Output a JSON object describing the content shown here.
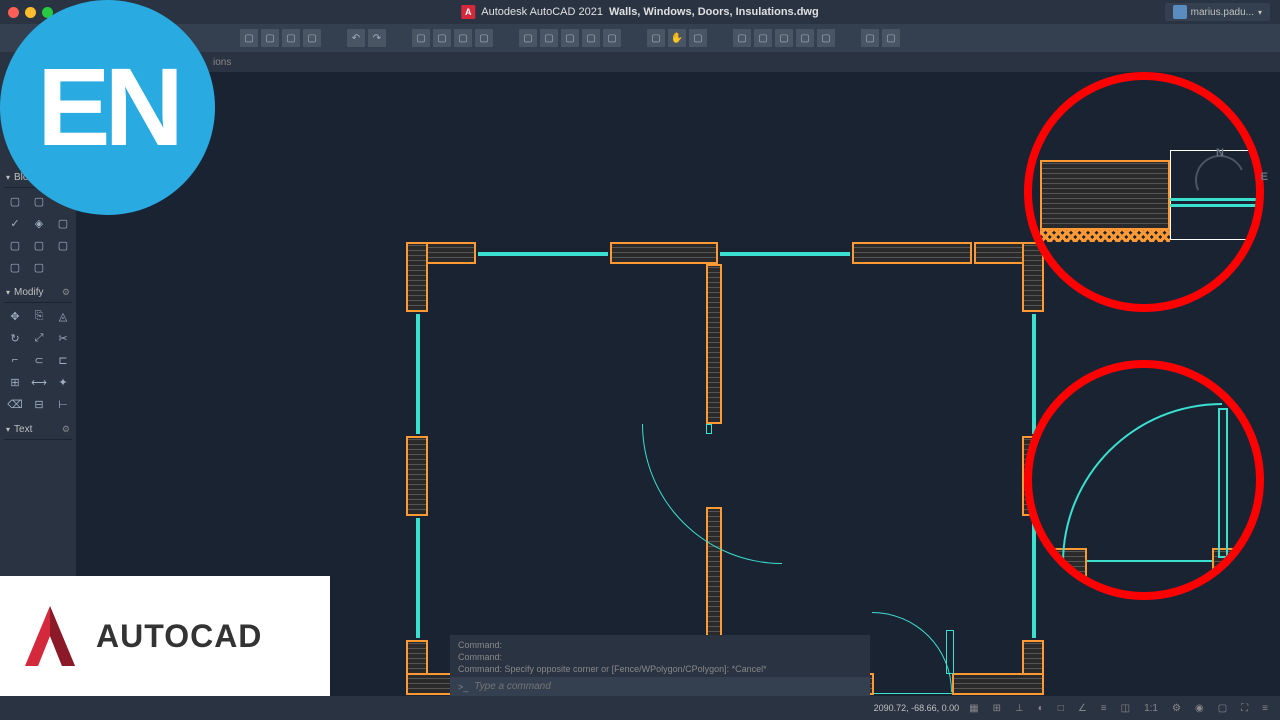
{
  "app": {
    "title_prefix": "Autodesk AutoCAD 2021",
    "filename": "Walls, Windows, Doors, Insulations.dwg",
    "user": "marius.padu..."
  },
  "ribbon": {
    "visible_tab_fragment": "ions"
  },
  "panels": {
    "block": "Block",
    "modify": "Modify",
    "text": "Text"
  },
  "command": {
    "line1": "Command:",
    "line2": "Command:",
    "line3": "Command: Specify opposite corner or [Fence/WPolygon/CPolygon]: *Cancel*",
    "prompt_prefix": ">_",
    "placeholder": "Type a command"
  },
  "status": {
    "coords": "2090.72, -68.66, 0.00",
    "scale": "1:1"
  },
  "nav": {
    "n": "N",
    "e": "E"
  },
  "badges": {
    "en": "EN",
    "autocad": "AUTOCAD"
  },
  "icons": {
    "gear": "⚙"
  }
}
